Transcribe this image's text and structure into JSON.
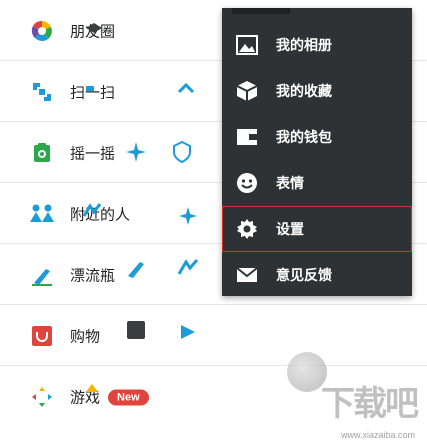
{
  "discover": {
    "items": [
      {
        "label": "朋友圈",
        "icon": "moments-icon"
      },
      {
        "label": "扫一扫",
        "icon": "scan-icon"
      },
      {
        "label": "摇一摇",
        "icon": "shake-icon"
      },
      {
        "label": "附近的人",
        "icon": "nearby-people-icon"
      },
      {
        "label": "漂流瓶",
        "icon": "drift-bottle-icon"
      },
      {
        "label": "购物",
        "icon": "shopping-icon"
      },
      {
        "label": "游戏",
        "icon": "games-icon",
        "badge": "New"
      }
    ]
  },
  "menu": {
    "items": [
      {
        "label": "我的相册",
        "icon": "album-icon"
      },
      {
        "label": "我的收藏",
        "icon": "favorites-icon"
      },
      {
        "label": "我的钱包",
        "icon": "wallet-icon"
      },
      {
        "label": "表情",
        "icon": "sticker-icon"
      },
      {
        "label": "设置",
        "icon": "settings-icon",
        "selected": true
      },
      {
        "label": "意见反馈",
        "icon": "feedback-icon"
      }
    ],
    "highlight_color": "#d9322c",
    "background_color": "#2f3234"
  },
  "watermark": {
    "text": "下载吧",
    "url": "www.xiazaiba.com"
  },
  "colors": {
    "badge": "#e0443c",
    "green": "#2aa84a"
  }
}
